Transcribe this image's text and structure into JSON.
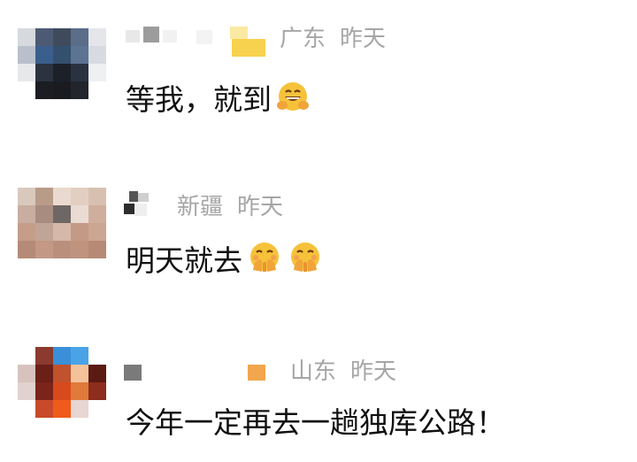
{
  "comments": [
    {
      "location": "广东",
      "time": "昨天",
      "text": "等我，就到",
      "emoji": [
        "grinning-hands-emoji"
      ]
    },
    {
      "location": "新疆",
      "time": "昨天",
      "text": "明天就去",
      "emoji": [
        "hand-over-mouth-emoji",
        "hand-over-mouth-emoji"
      ]
    },
    {
      "location": "山东",
      "time": "昨天",
      "text": "今年一定再去一趟独库公路！",
      "emoji": []
    }
  ],
  "colors": {
    "meta_text": "#a6a6a6",
    "body_text": "#111111",
    "emoji_face": "#f6c23a",
    "emoji_hands": "#f0a43a"
  }
}
